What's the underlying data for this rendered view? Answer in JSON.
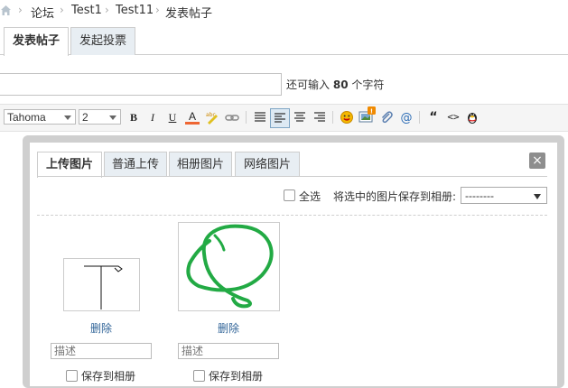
{
  "breadcrumb": {
    "items": [
      "论坛",
      "Test1",
      "Test11",
      "发表帖子"
    ],
    "separator": "›"
  },
  "tabs": [
    {
      "label": "发表帖子",
      "active": true
    },
    {
      "label": "发起投票",
      "active": false
    }
  ],
  "subject": {
    "value": "",
    "remaining_prefix": "还可输入",
    "remaining_count": "80",
    "remaining_suffix": "个字符"
  },
  "toolbar": {
    "font_family": "Tahoma",
    "font_size": "2",
    "bold": "B",
    "italic": "I",
    "underline": "U",
    "color": "A",
    "quote": "“",
    "code": "<>"
  },
  "dialog": {
    "tabs": [
      {
        "label": "上传图片",
        "active": true
      },
      {
        "label": "普通上传",
        "active": false
      },
      {
        "label": "相册图片",
        "active": false
      },
      {
        "label": "网络图片",
        "active": false
      }
    ],
    "close": "×",
    "select_all_label": "全选",
    "save_to_album_label": "将选中的图片保存到相册:",
    "album_select_value": "--------",
    "images": [
      {
        "delete_label": "删除",
        "description_placeholder": "描述",
        "save_label": "保存到相册"
      },
      {
        "delete_label": "删除",
        "description_placeholder": "描述",
        "save_label": "保存到相册"
      }
    ]
  },
  "colors": {
    "link": "#336699",
    "tab_inactive_bg": "#e8eef3",
    "dialog_border": "#cfcfcf",
    "green_stroke": "#22aa44"
  }
}
